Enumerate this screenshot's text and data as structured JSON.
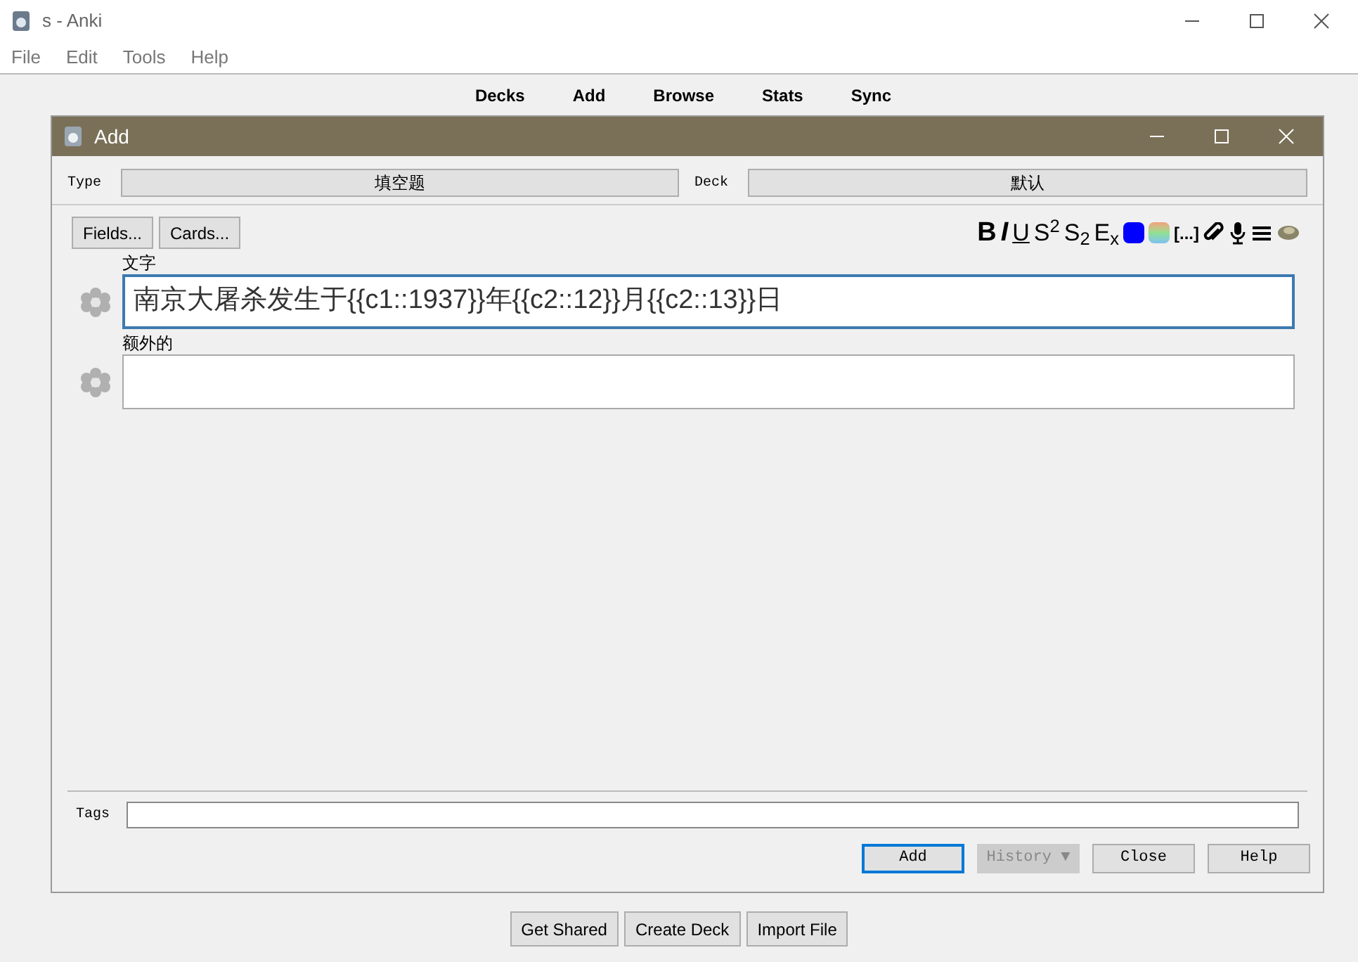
{
  "window": {
    "title": "s - Anki"
  },
  "menu": [
    "File",
    "Edit",
    "Tools",
    "Help"
  ],
  "main_toolbar": [
    "Decks",
    "Add",
    "Browse",
    "Stats",
    "Sync"
  ],
  "dialog": {
    "title": "Add",
    "type_label": "Type",
    "type_value": "填空题",
    "deck_label": "Deck",
    "deck_value": "默认",
    "buttons": [
      "Fields...",
      "Cards..."
    ],
    "format_tools": [
      {
        "kind": "bold",
        "label": "B"
      },
      {
        "kind": "italic",
        "label": "I"
      },
      {
        "kind": "underline",
        "label": "U"
      },
      {
        "kind": "plain",
        "label": "S$^{2}$"
      },
      {
        "kind": "plain",
        "label": "S$_{2}$"
      },
      {
        "kind": "plain",
        "label": "E$_{x}$"
      },
      {
        "kind": "swatch",
        "color": "#0000ff"
      },
      {
        "kind": "gradient"
      },
      {
        "kind": "cloze",
        "label": "[...]"
      },
      {
        "kind": "clip"
      },
      {
        "kind": "mic"
      },
      {
        "kind": "lines"
      },
      {
        "kind": "shell"
      }
    ],
    "fields": [
      {
        "name": "文字",
        "value": "南京大屠杀发生于{{c1::1937}}年{{c2::12}}月{{c2::13}}日",
        "focused": true
      },
      {
        "name": "额外的",
        "focused": false
      }
    ],
    "tags_label": "Tags",
    "actions": [
      {
        "label": "Add",
        "default": true,
        "disabled": false
      },
      {
        "label": "History ▼",
        "default": false,
        "disabled": true
      },
      {
        "label": "Close",
        "default": false,
        "disabled": false
      },
      {
        "label": "Help",
        "default": false,
        "disabled": false
      }
    ]
  },
  "bottom_buttons": [
    "Get Shared",
    "Create Deck",
    "Import File"
  ]
}
